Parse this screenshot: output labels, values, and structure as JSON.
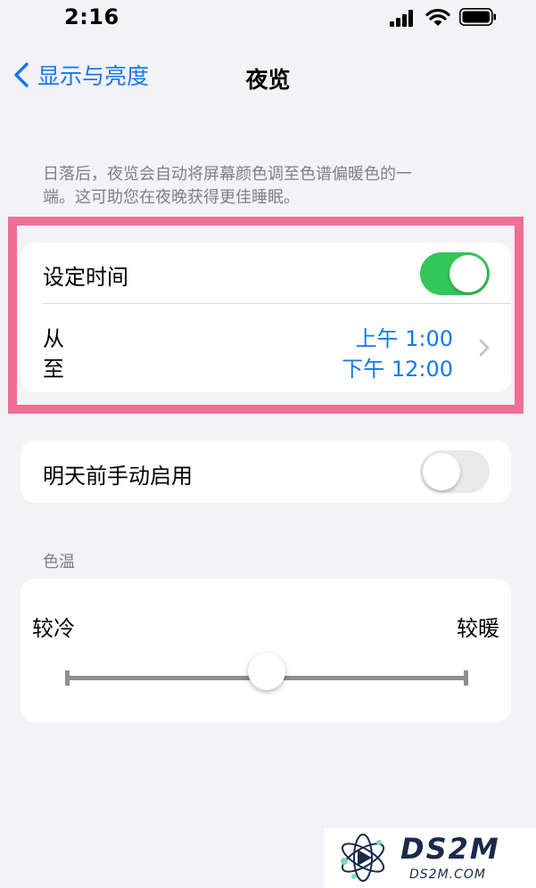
{
  "status_bar": {
    "time": "2:16"
  },
  "nav": {
    "back_label": "显示与亮度",
    "title": "夜览"
  },
  "description": {
    "line1": "日落后，夜览会自动将屏幕颜色调至色谱偏暖色的一",
    "line2": "端。这可助您在夜晚获得更佳睡眠。"
  },
  "schedule": {
    "label": "设定时间",
    "toggle_on": true,
    "from_label": "从",
    "to_label": "至",
    "from_time": "上午 1:00",
    "to_time": "下午 12:00"
  },
  "manual": {
    "label": "明天前手动启用",
    "toggle_on": false
  },
  "color_temperature": {
    "header": "色温",
    "cooler_label": "较冷",
    "warmer_label": "较暖",
    "slider_value": 0.5
  },
  "watermark": {
    "title": "DS2M",
    "subtitle": "DS2M.COM"
  },
  "colors": {
    "accent": "#1478f0",
    "toggle_on": "#34c759",
    "highlight": "#f06e95",
    "background": "#f2f2f7"
  }
}
